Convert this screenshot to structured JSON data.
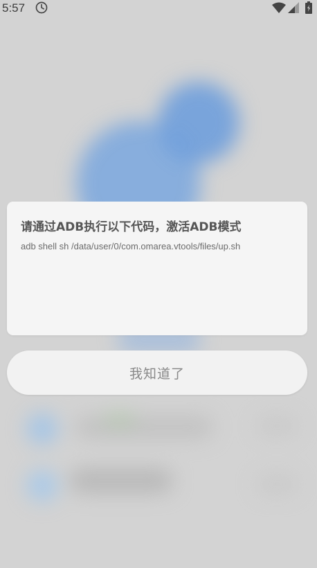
{
  "status_bar": {
    "time": "5:57",
    "icons": [
      "clock-icon",
      "wifi-icon",
      "signal-icon",
      "battery-icon"
    ]
  },
  "dialog": {
    "title": "请通过ADB执行以下代码，激活ADB模式",
    "message": "adb shell sh /data/user/0/com.omarea.vtools/files/up.sh",
    "button_label": "我知道了"
  },
  "colors": {
    "background": "#d3d3d3",
    "dialog_bg": "#f5f5f5",
    "blurred_accent": "#6f9fdc"
  }
}
